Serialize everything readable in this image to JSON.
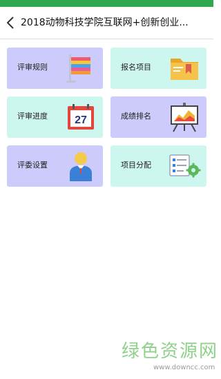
{
  "header": {
    "title": "2018动物科技学院互联网+创新创业..."
  },
  "tiles": [
    {
      "label": "评审规则",
      "icon": "flag-icon"
    },
    {
      "label": "报名项目",
      "icon": "folder-icon"
    },
    {
      "label": "评审进度",
      "icon": "calendar-icon",
      "calendar_day": "27"
    },
    {
      "label": "成绩排名",
      "icon": "presentation-chart-icon"
    },
    {
      "label": "评委设置",
      "icon": "judge-person-icon"
    },
    {
      "label": "项目分配",
      "icon": "list-settings-icon"
    }
  ],
  "watermark": {
    "brand": "绿色资源网",
    "url": "www.downcc.com"
  },
  "colors": {
    "status_bar": "#2fa84f",
    "tile_purple": "#cccbfb",
    "tile_mint": "#cdf7ee",
    "watermark_green": "#8fd18a"
  }
}
